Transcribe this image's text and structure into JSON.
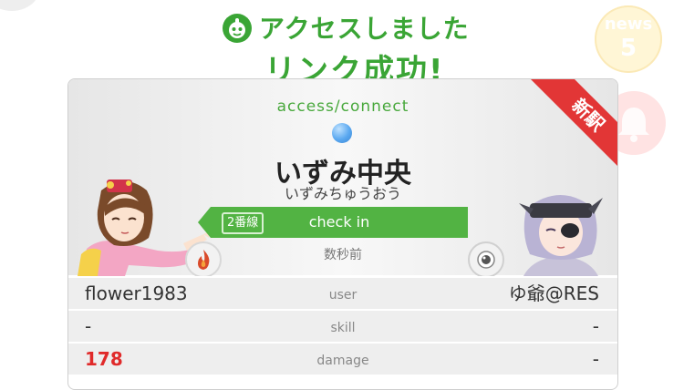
{
  "header": {
    "line1": "アクセスしました",
    "line2": "リンク成功!"
  },
  "news": {
    "label": "news",
    "count": "5"
  },
  "card": {
    "ribbon": "新駅",
    "access_label": "access/connect",
    "station_name": "いずみ中央",
    "station_kana": "いずみちゅうおう",
    "line_badge": "2番線",
    "checkin_label": "check in",
    "time_ago": "数秒前"
  },
  "stats": {
    "user": {
      "left": "flower1983",
      "label": "user",
      "right": "ゆ爺@RES"
    },
    "skill": {
      "left": "-",
      "label": "skill",
      "right": "-"
    },
    "damage": {
      "left": "178",
      "label": "damage",
      "right": "-"
    }
  },
  "colors": {
    "accent_green": "#3aa535",
    "checkin_green": "#52b343",
    "ribbon_red": "#e23636",
    "damage_red": "#e02a2a"
  }
}
